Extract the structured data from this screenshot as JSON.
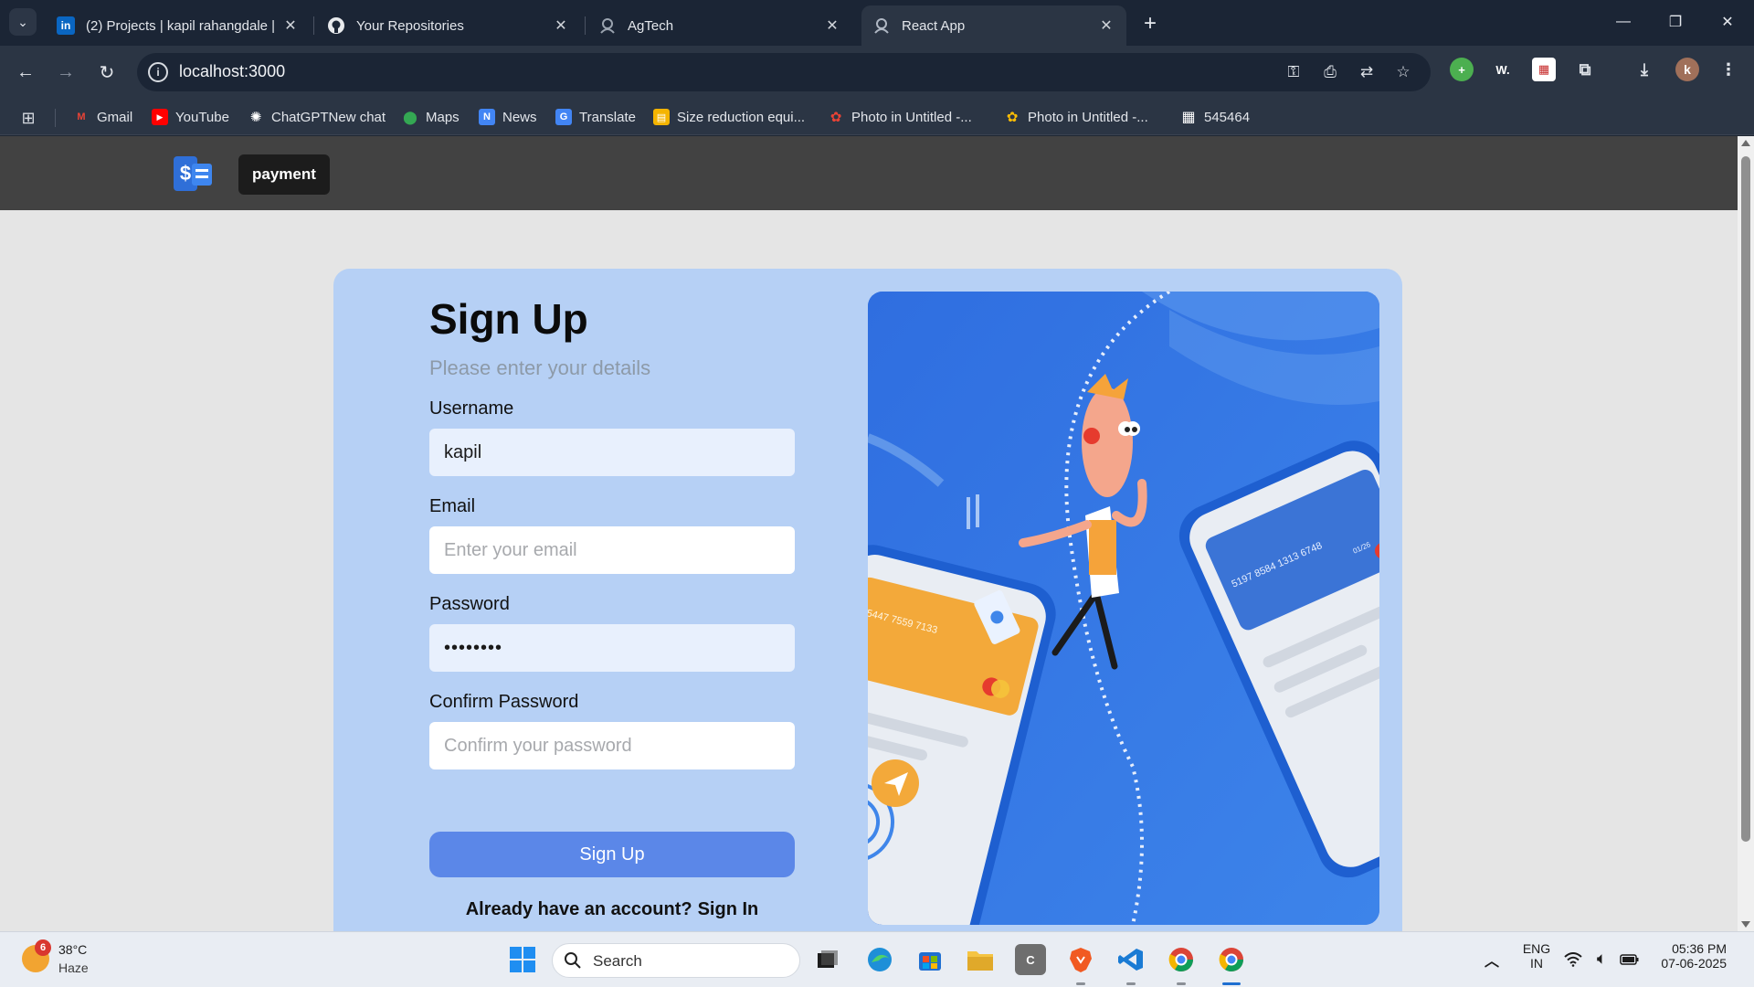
{
  "browser": {
    "tabs": [
      {
        "label": "(2) Projects | kapil rahangdale |",
        "icon": "linkedin-icon",
        "icon_text": "in",
        "color": "#0a66c2",
        "active": false
      },
      {
        "label": "Your Repositories",
        "icon": "github-icon",
        "color": "#ffffff",
        "active": false
      },
      {
        "label": "AgTech",
        "icon": "agtech-icon",
        "color": "#6b7280",
        "active": false
      },
      {
        "label": "React App",
        "icon": "react-icon",
        "color": "#9aa4b2",
        "active": true
      }
    ],
    "address": {
      "url": "localhost:3000"
    },
    "profile_initial": "k",
    "extensions": {
      "w_label": "W."
    }
  },
  "bookmarks": [
    {
      "label": "Gmail",
      "icon": "gmail-icon",
      "color": "#ea4335",
      "glyph": "M"
    },
    {
      "label": "YouTube",
      "icon": "youtube-icon",
      "color": "#ff0000",
      "glyph": "▶"
    },
    {
      "label": "ChatGPTNew chat",
      "icon": "chatgpt-icon",
      "color": "#ffffff",
      "glyph": "✺"
    },
    {
      "label": "Maps",
      "icon": "maps-icon",
      "color": "#34a853",
      "glyph": "⬤"
    },
    {
      "label": "News",
      "icon": "news-icon",
      "color": "#4285f4",
      "glyph": "N"
    },
    {
      "label": "Translate",
      "icon": "translate-icon",
      "color": "#4285f4",
      "glyph": "G"
    },
    {
      "label": "Size reduction equi...",
      "icon": "document-icon",
      "color": "#f4b400",
      "glyph": "▤"
    },
    {
      "label": "Photo in Untitled -...",
      "icon": "photos-icon",
      "color": "#ea4335",
      "glyph": "✿"
    },
    {
      "label": "Photo in Untitled -...",
      "icon": "photos-icon",
      "color": "#fbbc05",
      "glyph": "✿"
    },
    {
      "label": "545464",
      "icon": "sheet-icon",
      "color": "#ffffff",
      "glyph": "▦"
    }
  ],
  "app": {
    "brand_label": "payment",
    "form": {
      "title": "Sign Up",
      "subtitle": "Please enter your details",
      "username_label": "Username",
      "username_value": "kapil",
      "email_label": "Email",
      "email_placeholder": "Enter your email",
      "password_label": "Password",
      "password_value": "••••••••",
      "confirm_label": "Confirm Password",
      "confirm_placeholder": "Confirm your password",
      "submit_label": "Sign Up",
      "already_text": "Already have an account?",
      "signin_label": "Sign In"
    },
    "illustration": {
      "card_number_left": "5447 7559 7133",
      "card_number_right": "5197 8584 1313 6748",
      "card_expiry_right": "01/26"
    }
  },
  "taskbar": {
    "weather": {
      "temp": "38°C",
      "condition": "Haze",
      "badge": "6"
    },
    "search_label": "Search",
    "tray": {
      "lang": "ENG",
      "region": "IN",
      "time": "05:36 PM",
      "date": "07-06-2025"
    }
  }
}
